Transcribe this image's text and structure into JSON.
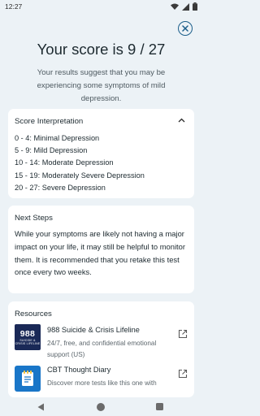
{
  "status_bar": {
    "time": "12:27",
    "wifi_icon": "wifi-icon",
    "signal_icon": "signal-icon",
    "battery_icon": "battery-icon"
  },
  "header": {
    "close_icon": "close-circle-icon",
    "score_title": "Your score is 9 / 27",
    "score_description": "Your results suggest that you may be experiencing some symptoms of mild depression."
  },
  "score_interpretation": {
    "title": "Score Interpretation",
    "expanded": true,
    "items": [
      "0 - 4: Minimal Depression",
      "5 - 9: Mild Depression",
      "10 - 14: Moderate Depression",
      "15 - 19: Moderately Severe Depression",
      "20 - 27: Severe Depression"
    ]
  },
  "next_steps": {
    "title": "Next Steps",
    "body": "While your symptoms are likely not having a major impact on your life, it may still be helpful to monitor them. It is recommended that you retake this test once every two weeks."
  },
  "resources": {
    "title": "Resources",
    "items": [
      {
        "logo_text": "988",
        "logo_subtext": "SUICIDE & CRISIS LIFELINE",
        "name": "988 Suicide & Crisis Lifeline",
        "description": "24/7, free, and confidential emotional support (US)"
      },
      {
        "logo_icon": "notepad-icon",
        "name": "CBT Thought Diary",
        "description": "Discover more tests like this one with"
      }
    ]
  },
  "colors": {
    "background": "#ecf2f6",
    "card": "#ffffff",
    "accent": "#1b5e8a"
  }
}
